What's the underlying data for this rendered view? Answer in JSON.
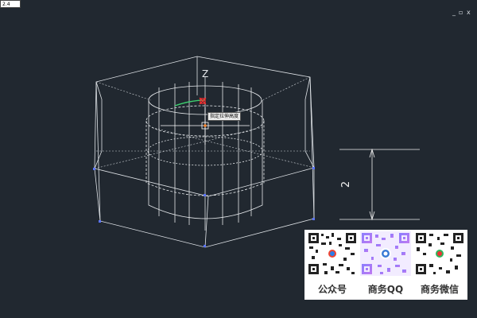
{
  "window_controls": {
    "minimize": "_",
    "restore": "▫",
    "close": "x"
  },
  "canvas": {
    "axis_label": "Z",
    "dimension_value": "2",
    "tooltip_text": "指定拉伸高度",
    "dynamic_input_value": "2.4"
  },
  "watermark": {
    "labels": [
      "公众号",
      "商务QQ",
      "商务微信"
    ]
  },
  "colors": {
    "background": "#212830",
    "wireframe": "#e6e9ec",
    "grip": "#5b74ff",
    "snap_marker": "#ff3030",
    "highlight_arc": "#3dcf6f",
    "dimension": "#f2f2f2"
  }
}
